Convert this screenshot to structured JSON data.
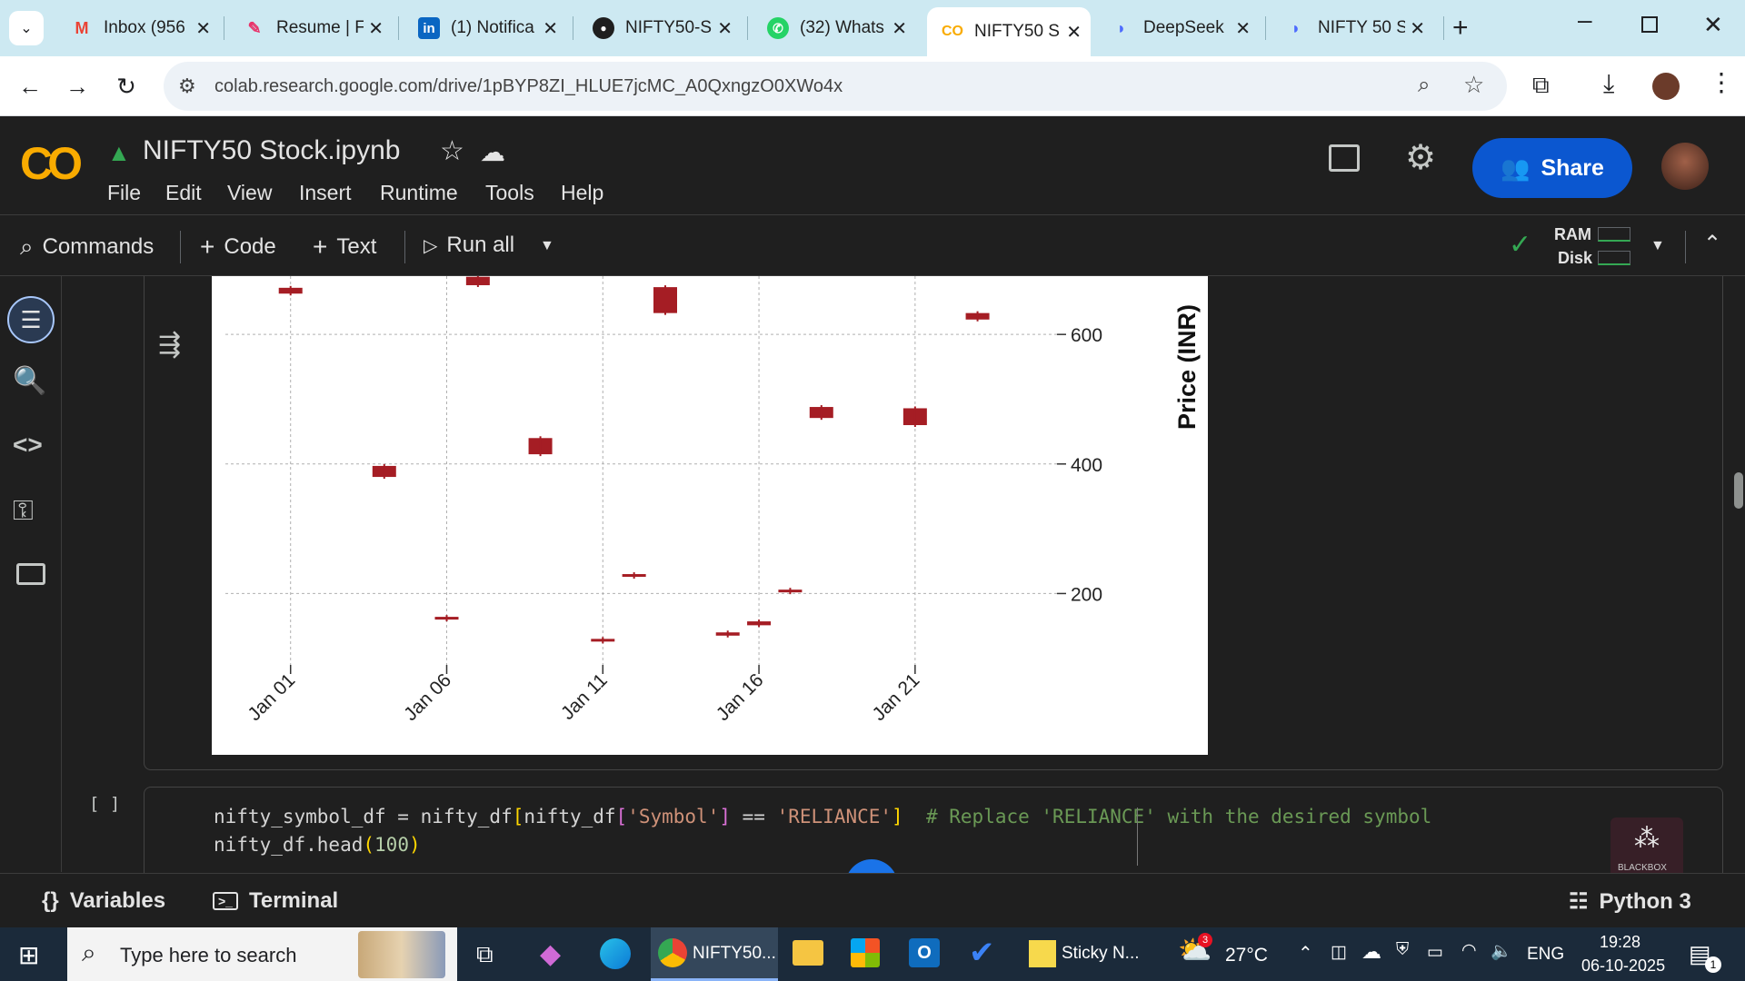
{
  "browser": {
    "tabs": [
      {
        "title": "Inbox (956",
        "icon": "gmail-icon",
        "active": false
      },
      {
        "title": "Resume | F",
        "icon": "resume-icon",
        "active": false
      },
      {
        "title": "(1) Notifica",
        "icon": "linkedin-icon",
        "active": false
      },
      {
        "title": "NIFTY50-S",
        "icon": "github-icon",
        "active": false
      },
      {
        "title": "(32) Whats",
        "icon": "whatsapp-icon",
        "active": false
      },
      {
        "title": "NIFTY50 S",
        "icon": "colab-icon",
        "active": true
      },
      {
        "title": "DeepSeek",
        "icon": "deepseek-icon",
        "active": false
      },
      {
        "title": "NIFTY 50 S",
        "icon": "deepseek-icon",
        "active": false
      }
    ],
    "url": "colab.research.google.com/drive/1pBYP8ZI_HLUE7jcMC_A0QxngzO0XWo4x"
  },
  "colab": {
    "logo": "CO",
    "notebook_title": "NIFTY50 Stock.ipynb",
    "menu": [
      "File",
      "Edit",
      "View",
      "Insert",
      "Runtime",
      "Tools",
      "Help"
    ],
    "share_label": "Share",
    "toolbar": {
      "commands": "Commands",
      "code": "Code",
      "text": "Text",
      "run_all": "Run all",
      "ram": "RAM",
      "disk": "Disk"
    },
    "code_cell": {
      "exec_marker": "[ ]",
      "line1_a": "nifty_symbol_df = nifty_df",
      "line1_b": "[",
      "line1_c": "nifty_df",
      "line1_d": "[",
      "line1_e": "'Symbol'",
      "line1_f": "]",
      "line1_g": " == ",
      "line1_h": "'RELIANCE'",
      "line1_i": "]",
      "line1_j": "  # Replace 'RELIANCE' with the desired symbol",
      "line2_a": "nifty_df.head",
      "line2_b": "(",
      "line2_c": "100",
      "line2_d": ")"
    },
    "bottom": {
      "variables": "Variables",
      "terminal": "Terminal",
      "runtime": "Python 3"
    },
    "blackbox_label": "BLACKBOX"
  },
  "chart_data": {
    "type": "candlestick",
    "ylabel": "Price (INR)",
    "yticks": [
      200,
      400,
      600
    ],
    "ylim": [
      80,
      690
    ],
    "xticks": [
      "Jan 01",
      "Jan 06",
      "Jan 11",
      "Jan 16",
      "Jan 21"
    ],
    "xlim": [
      -1,
      27
    ],
    "grid": true,
    "color": "#a51d24",
    "candles": [
      {
        "day": 1,
        "open": 672,
        "close": 663
      },
      {
        "day": 4,
        "open": 397,
        "close": 380
      },
      {
        "day": 6,
        "open": 164,
        "close": 161
      },
      {
        "day": 7,
        "open": 689,
        "close": 676
      },
      {
        "day": 9,
        "open": 440,
        "close": 415
      },
      {
        "day": 11,
        "open": 130,
        "close": 126
      },
      {
        "day": 12,
        "open": 230,
        "close": 226
      },
      {
        "day": 13,
        "open": 673,
        "close": 633
      },
      {
        "day": 15,
        "open": 140,
        "close": 135
      },
      {
        "day": 16,
        "open": 157,
        "close": 151
      },
      {
        "day": 17,
        "open": 206,
        "close": 203
      },
      {
        "day": 18,
        "open": 488,
        "close": 471
      },
      {
        "day": 21,
        "open": 486,
        "close": 460
      },
      {
        "day": 23,
        "open": 633,
        "close": 623
      }
    ]
  },
  "taskbar": {
    "search_placeholder": "Type here to search",
    "chrome_label": "NIFTY50...",
    "sticky_label": "Sticky N...",
    "weather": "27°C",
    "weather_badge": "3",
    "lang": "ENG",
    "time": "19:28",
    "date": "06-10-2025",
    "notif_count": "1"
  }
}
